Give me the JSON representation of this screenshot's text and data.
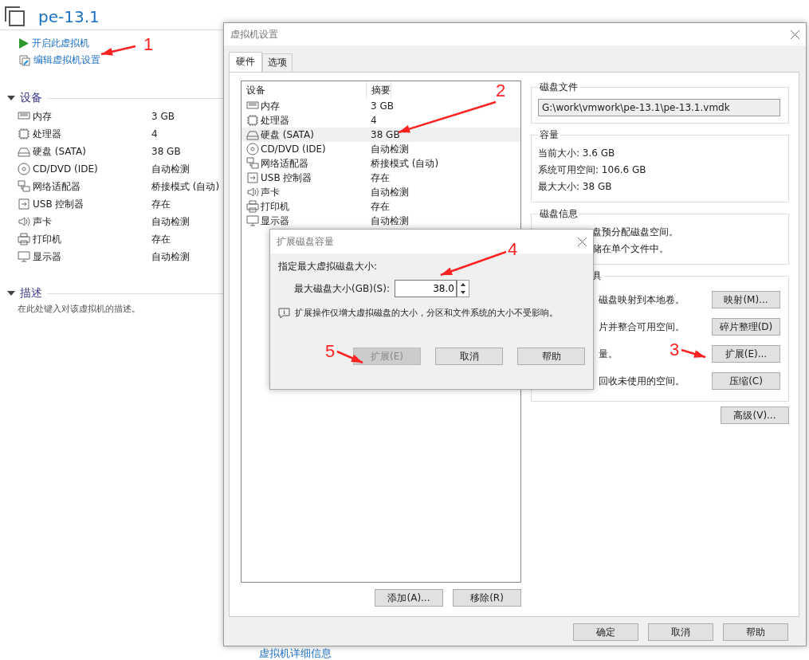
{
  "main": {
    "title": "pe-13.1",
    "actions": [
      {
        "label": "开启此虚拟机",
        "kind": "play"
      },
      {
        "label": "编辑虚拟机设置",
        "kind": "edit"
      }
    ],
    "devices_heading": "设备",
    "devices": [
      {
        "name": "内存",
        "value": "3 GB",
        "kind": "memory"
      },
      {
        "name": "处理器",
        "value": "4",
        "kind": "cpu"
      },
      {
        "name": "硬盘 (SATA)",
        "value": "38 GB",
        "kind": "disk"
      },
      {
        "name": "CD/DVD (IDE)",
        "value": "自动检测",
        "kind": "cd"
      },
      {
        "name": "网络适配器",
        "value": "桥接模式 (自动)",
        "kind": "network"
      },
      {
        "name": "USB 控制器",
        "value": "存在",
        "kind": "usb"
      },
      {
        "name": "声卡",
        "value": "自动检测",
        "kind": "sound"
      },
      {
        "name": "打印机",
        "value": "存在",
        "kind": "printer"
      },
      {
        "name": "显示器",
        "value": "自动检测",
        "kind": "display"
      }
    ],
    "description_heading": "描述",
    "description_placeholder": "在此处键入对该虚拟机的描述。",
    "details_link": "虚拟机详细信息"
  },
  "settings": {
    "title": "虚拟机设置",
    "tabs": [
      {
        "label": "硬件",
        "selected": true
      },
      {
        "label": "选项",
        "selected": false
      }
    ],
    "columns": [
      "设备",
      "摘要"
    ],
    "devices": [
      {
        "name": "内存",
        "value": "3 GB",
        "kind": "memory",
        "selected": false
      },
      {
        "name": "处理器",
        "value": "4",
        "kind": "cpu",
        "selected": false
      },
      {
        "name": "硬盘 (SATA)",
        "value": "38 GB",
        "kind": "disk",
        "selected": true
      },
      {
        "name": "CD/DVD (IDE)",
        "value": "自动检测",
        "kind": "cd",
        "selected": false
      },
      {
        "name": "网络适配器",
        "value": "桥接模式 (自动)",
        "kind": "network",
        "selected": false
      },
      {
        "name": "USB 控制器",
        "value": "存在",
        "kind": "usb",
        "selected": false
      },
      {
        "name": "声卡",
        "value": "自动检测",
        "kind": "sound",
        "selected": false
      },
      {
        "name": "打印机",
        "value": "存在",
        "kind": "printer",
        "selected": false
      },
      {
        "name": "显示器",
        "value": "自动检测",
        "kind": "display",
        "selected": false
      }
    ],
    "add_button": "添加(A)...",
    "remove_button": "移除(R)",
    "disk_file": {
      "heading": "磁盘文件",
      "value": "G:\\work\\vmwork\\pe-13.1\\pe-13.1.vmdk"
    },
    "capacity": {
      "heading": "容量",
      "lines": [
        "当前大小: 3.6 GB",
        "系统可用空间: 106.6 GB",
        "最大大小: 38 GB"
      ]
    },
    "disk_info": {
      "heading": "磁盘信息",
      "lines": [
        "盘预分配磁盘空间。",
        "储在单个文件中。"
      ]
    },
    "utilities": {
      "heading": "具",
      "rows": [
        {
          "text": "磁盘映射到本地卷。",
          "button": "映射(M)..."
        },
        {
          "text": "片并整合可用空间。",
          "button": "碎片整理(D)"
        },
        {
          "text": "量。",
          "button": "扩展(E)..."
        },
        {
          "text": "回收未使用的空间。",
          "button": "压缩(C)"
        }
      ]
    },
    "advanced_button": "高级(V)...",
    "buttons": [
      "确定",
      "取消",
      "帮助"
    ]
  },
  "expand_dialog": {
    "title": "扩展磁盘容量",
    "prompt": "指定最大虚拟磁盘大小:",
    "field_label": "最大磁盘大小(GB)(S):",
    "value": "38.0",
    "note": "扩展操作仅增大虚拟磁盘的大小，分区和文件系统的大小不受影响。",
    "buttons": [
      {
        "label": "扩展(E)",
        "disabled": true
      },
      {
        "label": "取消",
        "disabled": false
      },
      {
        "label": "帮助",
        "disabled": false
      }
    ]
  },
  "annotations": [
    "1",
    "2",
    "3",
    "4",
    "5"
  ]
}
